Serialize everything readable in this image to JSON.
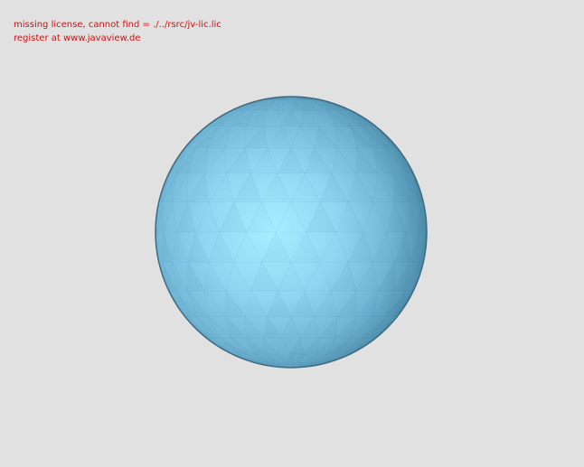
{
  "license_notice": {
    "line1": "missing license, cannot find = ./../rsrc/jv-lic.lic",
    "line2": "register at www.javaview.de"
  },
  "scene": {
    "object": "sphere",
    "colors": {
      "background": "#e1e1e1",
      "notice_text": "#d01010",
      "sphere_highlight": "#a6eeff",
      "sphere_mid": "#80c8e8",
      "sphere_shadow": "#4f8fae",
      "sphere_edge": "#3e6a80"
    }
  }
}
